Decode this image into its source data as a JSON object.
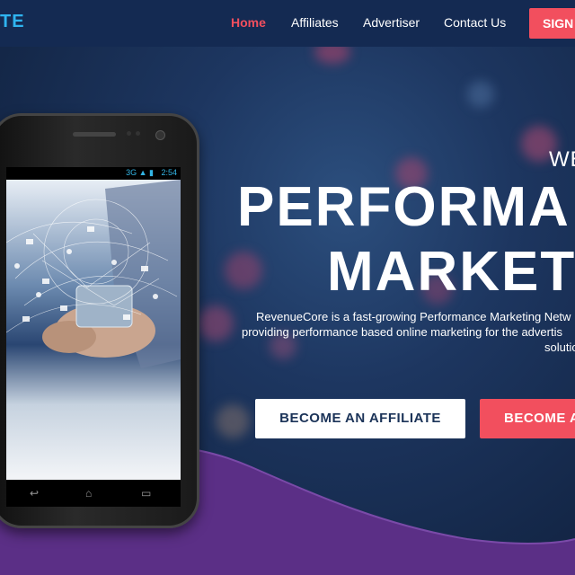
{
  "nav": {
    "logo": "TE",
    "links": [
      "Home",
      "Affiliates",
      "Advertiser",
      "Contact Us"
    ],
    "signup": "SIGN"
  },
  "hero": {
    "welcome": "WE",
    "headline_line1": "PERFORMA",
    "headline_line2": "MARKET",
    "description": [
      "RevenueCore is a fast-growing Performance Marketing Netw",
      "providing performance based online marketing for the advertis",
      "solutio"
    ],
    "cta_affiliate": "BECOME AN AFFILIATE",
    "cta_advertiser": "BECOME A"
  },
  "phone": {
    "time": "2:54",
    "network": "3G"
  },
  "colors": {
    "accent": "#f24f5e",
    "navy": "#142a52",
    "logo_blue": "#2fb4f0",
    "wave_purple": "#5b2f86"
  },
  "icons": {
    "back": "back-arrow-icon",
    "home": "home-icon",
    "recent": "recent-apps-icon"
  }
}
